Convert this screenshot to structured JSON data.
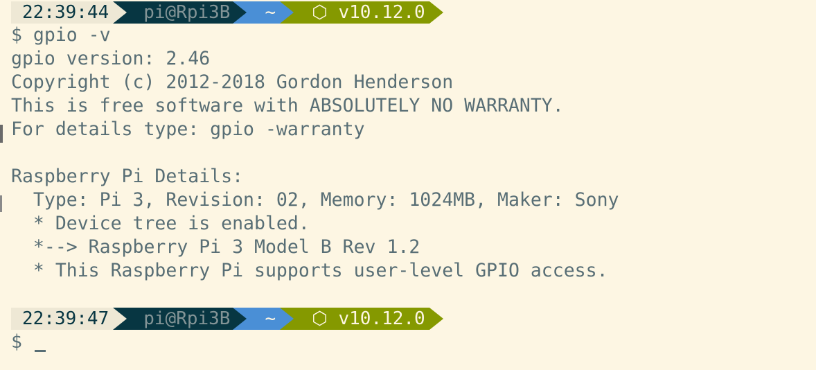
{
  "prompt1": {
    "time": "22:39:44",
    "user_host": "pi@Rpi3B",
    "dir": "~",
    "node_icon": "⬡",
    "node_version": "v10.12.0"
  },
  "command": "$ gpio -v",
  "output": {
    "line1": "gpio version: 2.46",
    "line2": "Copyright (c) 2012-2018 Gordon Henderson",
    "line3": "This is free software with ABSOLUTELY NO WARRANTY.",
    "line4": "For details type: gpio -warranty",
    "line5": "Raspberry Pi Details:",
    "line6": "  Type: Pi 3, Revision: 02, Memory: 1024MB, Maker: Sony",
    "line7": "  * Device tree is enabled.",
    "line8": "  *--> Raspberry Pi 3 Model B Rev 1.2",
    "line9": "  * This Raspberry Pi supports user-level GPIO access."
  },
  "prompt2": {
    "time": "22:39:47",
    "user_host": "pi@Rpi3B",
    "dir": "~",
    "node_icon": "⬡",
    "node_version": "v10.12.0"
  },
  "input_prompt": "$ "
}
